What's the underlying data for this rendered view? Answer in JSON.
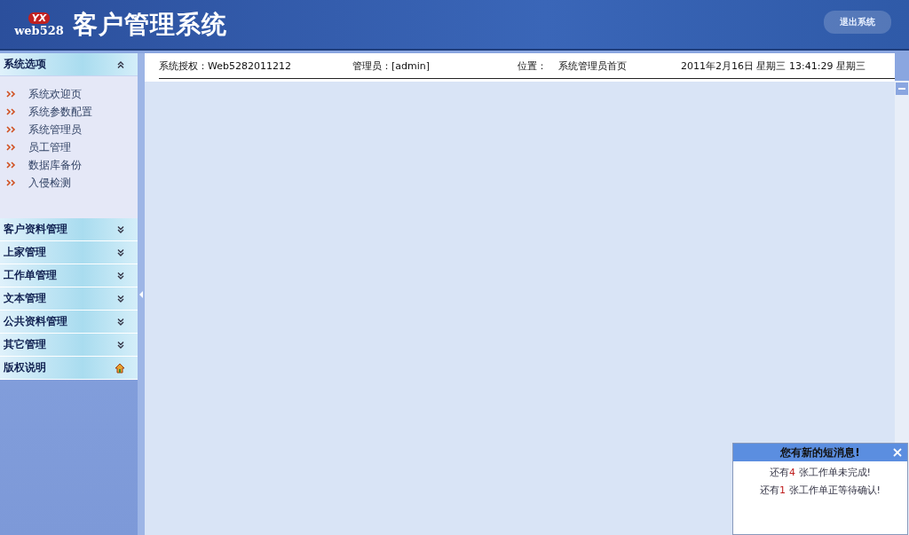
{
  "header": {
    "logo_top": "YX",
    "logo_bottom": "web528",
    "title": "客户管理系统",
    "logout": "退出系统"
  },
  "sidebar": {
    "sections": [
      {
        "label": "系统选项",
        "expanded": true,
        "kind": "chevron",
        "items": [
          "系统欢迎页",
          "系统参数配置",
          "系统管理员",
          "员工管理",
          "数据库备份",
          "入侵检测"
        ]
      },
      {
        "label": "客户资料管理",
        "expanded": false,
        "kind": "chevron"
      },
      {
        "label": "上家管理",
        "expanded": false,
        "kind": "chevron"
      },
      {
        "label": "工作单管理",
        "expanded": false,
        "kind": "chevron"
      },
      {
        "label": "文本管理",
        "expanded": false,
        "kind": "chevron"
      },
      {
        "label": "公共资料管理",
        "expanded": false,
        "kind": "chevron"
      },
      {
        "label": "其它管理",
        "expanded": false,
        "kind": "chevron"
      },
      {
        "label": "版权说明",
        "kind": "home"
      }
    ]
  },
  "info_bar": {
    "license": "系统授权：Web5282011212",
    "admin": "管理员：[admin]",
    "location_label": "位置：",
    "location": "系统管理员首页",
    "datetime": "2011年2月16日 星期三 13:41:29 星期三"
  },
  "message_popup": {
    "title": "您有新的短消息!",
    "lines": [
      {
        "before": "还有",
        "count": "4",
        "after": " 张工作单未完成!"
      },
      {
        "before": "还有",
        "count": "1",
        "after": " 张工作单正等待确认!"
      }
    ]
  }
}
